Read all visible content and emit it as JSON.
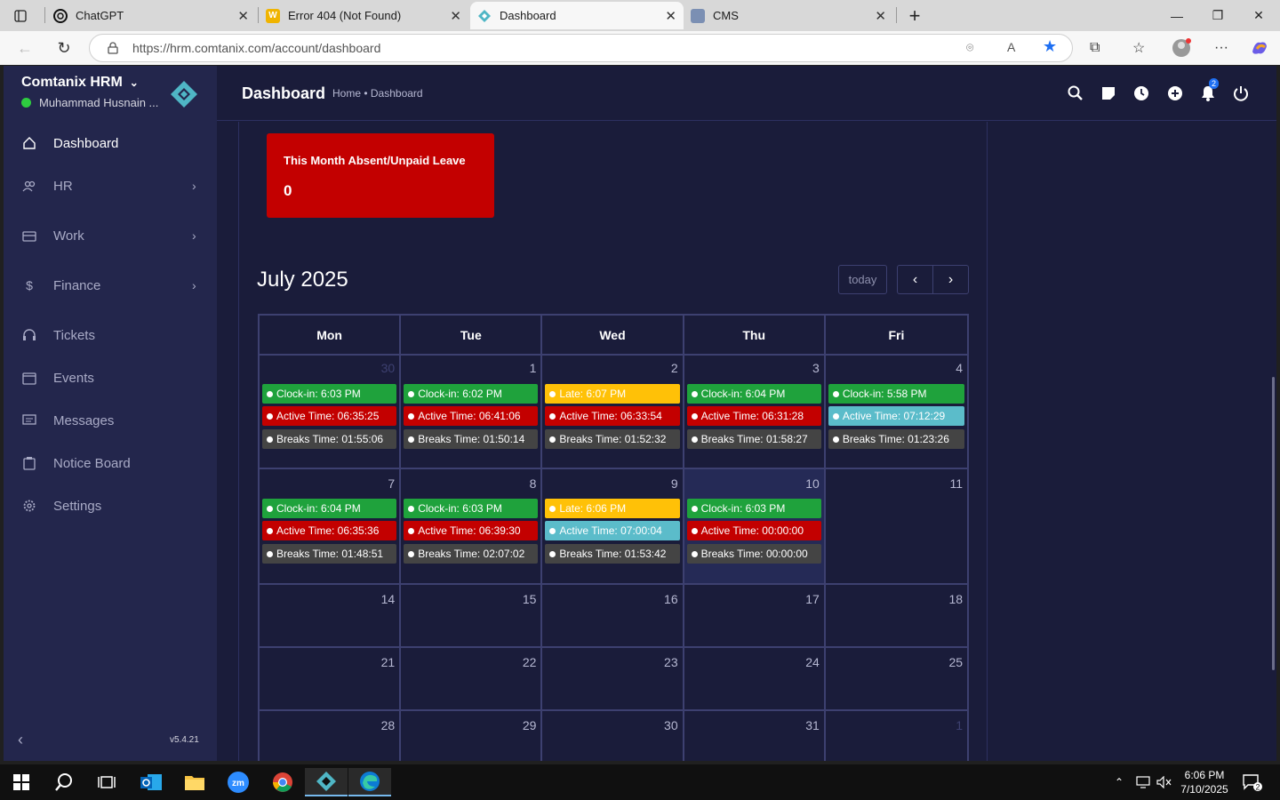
{
  "browser": {
    "tabs": [
      {
        "title": "ChatGPT",
        "icon": "chatgpt-icon"
      },
      {
        "title": "Error 404 (Not Found)",
        "icon": "w-icon"
      },
      {
        "title": "Dashboard",
        "icon": "app-icon"
      },
      {
        "title": "CMS",
        "icon": "cms-icon"
      }
    ],
    "url": "https://hrm.comtanix.com/account/dashboard"
  },
  "sidebar": {
    "brand": "Comtanix HRM",
    "user": "Muhammad Husnain ...",
    "items": [
      {
        "label": "Dashboard",
        "icon": "home-icon"
      },
      {
        "label": "HR",
        "icon": "users-icon"
      },
      {
        "label": "Work",
        "icon": "briefcase-icon"
      },
      {
        "label": "Finance",
        "icon": "dollar-icon"
      },
      {
        "label": "Tickets",
        "icon": "headset-icon"
      },
      {
        "label": "Events",
        "icon": "calendar-icon"
      },
      {
        "label": "Messages",
        "icon": "message-icon"
      },
      {
        "label": "Notice Board",
        "icon": "clipboard-icon"
      },
      {
        "label": "Settings",
        "icon": "gear-icon"
      }
    ],
    "version": "v5.4.21"
  },
  "header": {
    "title": "Dashboard",
    "breadcrumb": "Home • Dashboard",
    "notification_count": "2"
  },
  "card": {
    "title": "This Month Absent/Unpaid Leave",
    "value": "0"
  },
  "calendar": {
    "title": "July 2025",
    "today_label": "today",
    "days": [
      "Mon",
      "Tue",
      "Wed",
      "Thu",
      "Fri"
    ],
    "weeks": [
      {
        "dates": [
          "30",
          "1",
          "2",
          "3",
          "4"
        ]
      },
      {
        "dates": [
          "7",
          "8",
          "9",
          "10",
          "11"
        ]
      },
      {
        "dates": [
          "14",
          "15",
          "16",
          "17",
          "18"
        ]
      },
      {
        "dates": [
          "21",
          "22",
          "23",
          "24",
          "25"
        ]
      },
      {
        "dates": [
          "28",
          "29",
          "30",
          "31",
          "1"
        ]
      }
    ],
    "events": {
      "w0": [
        [
          "Clock-in: 6:03 PM",
          "Active Time: 06:35:25",
          "Breaks Time: 01:55:06"
        ],
        [
          "Clock-in: 6:02 PM",
          "Active Time: 06:41:06",
          "Breaks Time: 01:50:14"
        ],
        [
          "Late: 6:07 PM",
          "Active Time: 06:33:54",
          "Breaks Time: 01:52:32"
        ],
        [
          "Clock-in: 6:04 PM",
          "Active Time: 06:31:28",
          "Breaks Time: 01:58:27"
        ],
        [
          "Clock-in: 5:58 PM",
          "Active Time: 07:12:29",
          "Breaks Time: 01:23:26"
        ]
      ],
      "w1": [
        [
          "Clock-in: 6:04 PM",
          "Active Time: 06:35:36",
          "Breaks Time: 01:48:51"
        ],
        [
          "Clock-in: 6:03 PM",
          "Active Time: 06:39:30",
          "Breaks Time: 02:07:02"
        ],
        [
          "Late: 6:06 PM",
          "Active Time: 07:00:04",
          "Breaks Time: 01:53:42"
        ],
        [
          "Clock-in: 6:03 PM",
          "Active Time: 00:00:00",
          "Breaks Time: 00:00:00"
        ]
      ]
    }
  },
  "taskbar": {
    "time": "6:06 PM",
    "date": "7/10/2025",
    "notif": "2"
  }
}
